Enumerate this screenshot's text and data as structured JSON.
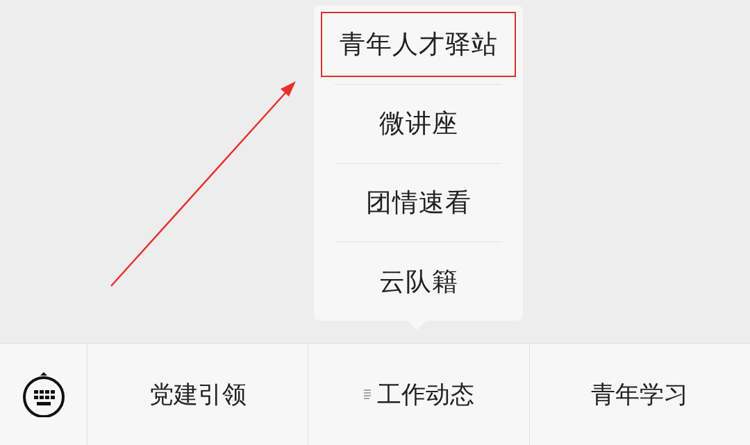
{
  "popup_menu": {
    "items": [
      {
        "label": "青年人才驿站",
        "highlighted": true
      },
      {
        "label": "微讲座",
        "highlighted": false
      },
      {
        "label": "团情速看",
        "highlighted": false
      },
      {
        "label": "云队籍",
        "highlighted": false
      }
    ]
  },
  "annotation": {
    "kind": "arrow"
  },
  "menu_bar": {
    "items": [
      {
        "label": "党建引领",
        "has_submenu": false
      },
      {
        "label": "工作动态",
        "has_submenu": true
      },
      {
        "label": "青年学习",
        "has_submenu": false
      }
    ]
  }
}
